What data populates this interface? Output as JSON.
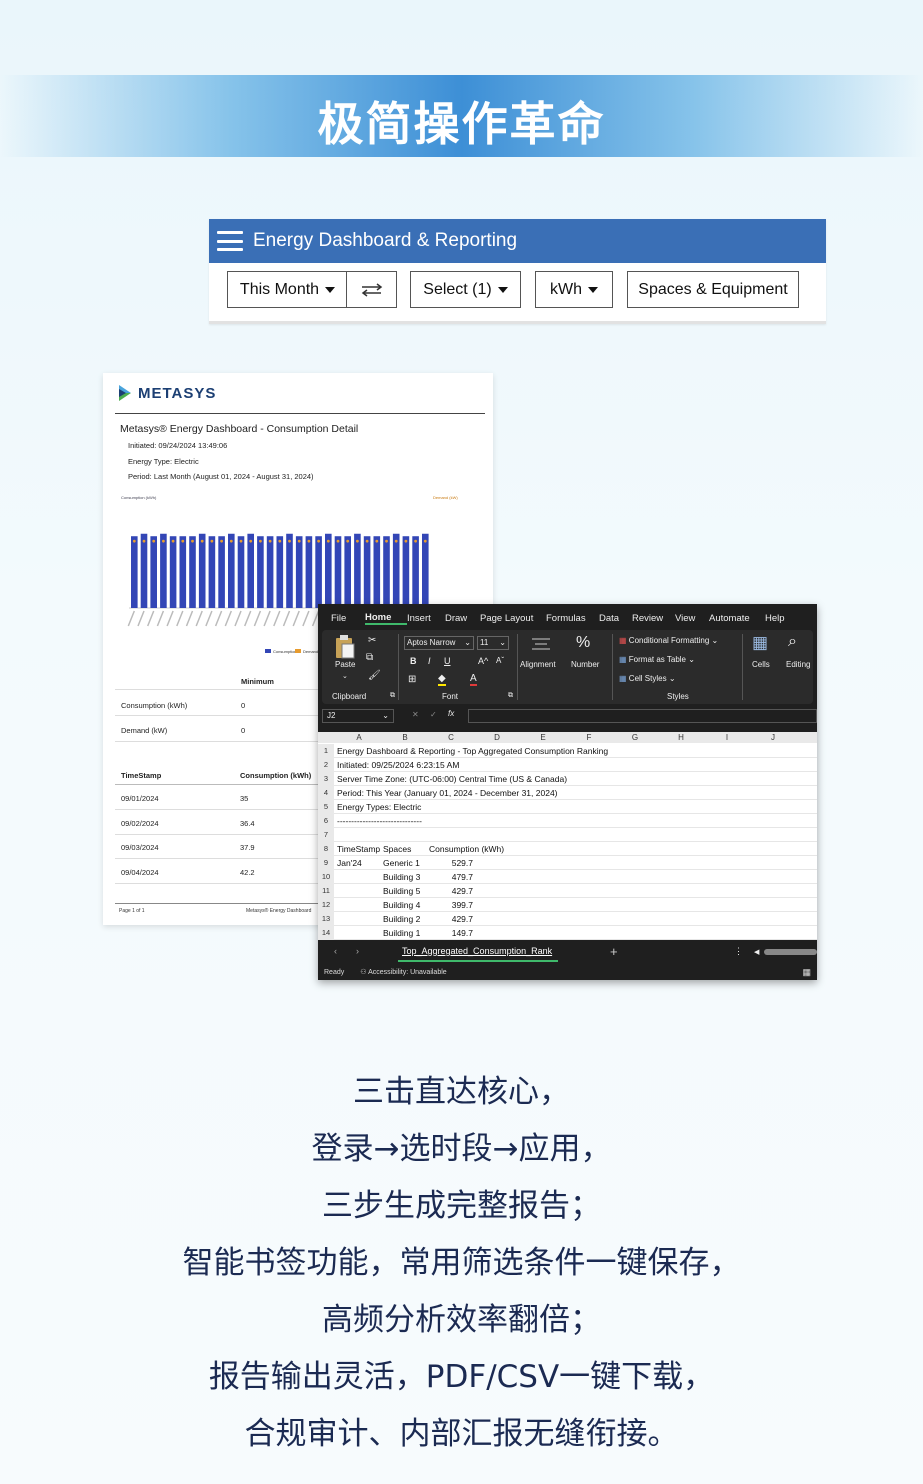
{
  "banner": {
    "title": "极简操作革命"
  },
  "dashboard": {
    "title": "Energy Dashboard & Reporting",
    "period_button": "This Month",
    "select_button": "Select (1)",
    "unit_button": "kWh",
    "spaces_button": "Spaces & Equipment",
    "compare_icon": "swap-arrows-icon"
  },
  "pdf": {
    "logo": "METASYS",
    "title": "Metasys® Energy Dashboard - Consumption Detail",
    "initiated": "Initiated: 09/24/2024 13:49:06",
    "energy_type": "Energy Type: Electric",
    "period": "Period: Last Month (August 01, 2024 - August 31, 2024)",
    "chart_left_label": "Consumption (kWh)",
    "chart_right_label": "Demand (kW)",
    "legend": [
      "Consumption",
      "Demand"
    ],
    "stats_header": "Minimum",
    "stats_rows": [
      {
        "label": "Consumption (kWh)",
        "min": "0"
      },
      {
        "label": "Demand (kW)",
        "min": "0"
      }
    ],
    "detail_headers": [
      "TimeStamp",
      "Consumption (kWh)"
    ],
    "detail_rows": [
      {
        "date": "09/01/2024",
        "value": "35"
      },
      {
        "date": "09/02/2024",
        "value": "36.4"
      },
      {
        "date": "09/03/2024",
        "value": "37.9"
      },
      {
        "date": "09/04/2024",
        "value": "42.2"
      }
    ],
    "footer_page": "Page 1 of 1",
    "footer_brand": "Metasys® Energy Dashboard"
  },
  "excel": {
    "menu": [
      "File",
      "Home",
      "Insert",
      "Draw",
      "Page Layout",
      "Formulas",
      "Data",
      "Review",
      "View",
      "Automate",
      "Help"
    ],
    "ribbon": {
      "paste": "Paste",
      "clipboard": "Clipboard",
      "font_name": "Aptos Narrow",
      "font_size": "11",
      "font": "Font",
      "alignment": "Alignment",
      "number": "Number",
      "conditional": "Conditional Formatting",
      "format_table": "Format as Table",
      "cell_styles": "Cell Styles",
      "styles": "Styles",
      "cells": "Cells",
      "editing": "Editing"
    },
    "name_box": "J2",
    "columns": [
      "A",
      "B",
      "C",
      "D",
      "E",
      "F",
      "G",
      "H",
      "I",
      "J"
    ],
    "rows": [
      {
        "n": "1",
        "a": "Energy Dashboard & Reporting - Top Aggregated Consumption Ranking",
        "b": "",
        "c": ""
      },
      {
        "n": "2",
        "a": "Initiated: 09/25/2024 6:23:15 AM",
        "b": "",
        "c": ""
      },
      {
        "n": "3",
        "a": "Server Time Zone: (UTC-06:00) Central Time (US & Canada)",
        "b": "",
        "c": ""
      },
      {
        "n": "4",
        "a": "Period: This Year (January 01, 2024 - December 31, 2024)",
        "b": "",
        "c": ""
      },
      {
        "n": "5",
        "a": "Energy Types: Electric",
        "b": "",
        "c": ""
      },
      {
        "n": "6",
        "a": "------------------------------",
        "b": "",
        "c": ""
      },
      {
        "n": "7",
        "a": "",
        "b": "",
        "c": ""
      },
      {
        "n": "8",
        "a": "TimeStamp",
        "b": "Spaces",
        "c": "Consumption (kWh)"
      },
      {
        "n": "9",
        "a": "Jan'24",
        "b": "Generic 1",
        "c": "529.7"
      },
      {
        "n": "10",
        "a": "",
        "b": "Building 3",
        "c": "479.7"
      },
      {
        "n": "11",
        "a": "",
        "b": "Building 5",
        "c": "429.7"
      },
      {
        "n": "12",
        "a": "",
        "b": "Building 4",
        "c": "399.7"
      },
      {
        "n": "13",
        "a": "",
        "b": "Building 2",
        "c": "429.7"
      },
      {
        "n": "14",
        "a": "",
        "b": "Building 1",
        "c": "149.7"
      }
    ],
    "sheet_tab": "Top_Aggregated_Consumption_Rank",
    "status_ready": "Ready",
    "status_access": "Accessibility: Unavailable"
  },
  "captions": [
    "三击直达核心，",
    "登录→选时段→应用，",
    "三步生成完整报告；",
    "智能书签功能，常用筛选条件一键保存，",
    "高频分析效率翻倍；",
    "报告输出灵活，PDF/CSV一键下载，",
    "合规审计、内部汇报无缝衔接。"
  ],
  "chart_data": {
    "type": "bar",
    "title": "",
    "ylabel": "Consumption (kWh)",
    "y2label": "Demand (kW)",
    "series": [
      {
        "name": "Consumption",
        "values": [
          29,
          30,
          29,
          30,
          29,
          29,
          29,
          30,
          29,
          29,
          30,
          29,
          30,
          29,
          29,
          29,
          30,
          29,
          29,
          29,
          30,
          29,
          29,
          30,
          29,
          29,
          29,
          30,
          29,
          29,
          30
        ]
      },
      {
        "name": "Demand",
        "values": [
          27,
          27,
          27,
          27,
          27,
          27,
          27,
          27,
          27,
          27,
          27,
          27,
          27,
          27,
          27,
          27,
          27,
          27,
          27,
          27,
          27,
          27,
          27,
          27,
          27,
          27,
          27,
          27,
          27,
          27,
          27
        ]
      }
    ],
    "ylim": [
      0,
      40
    ]
  }
}
